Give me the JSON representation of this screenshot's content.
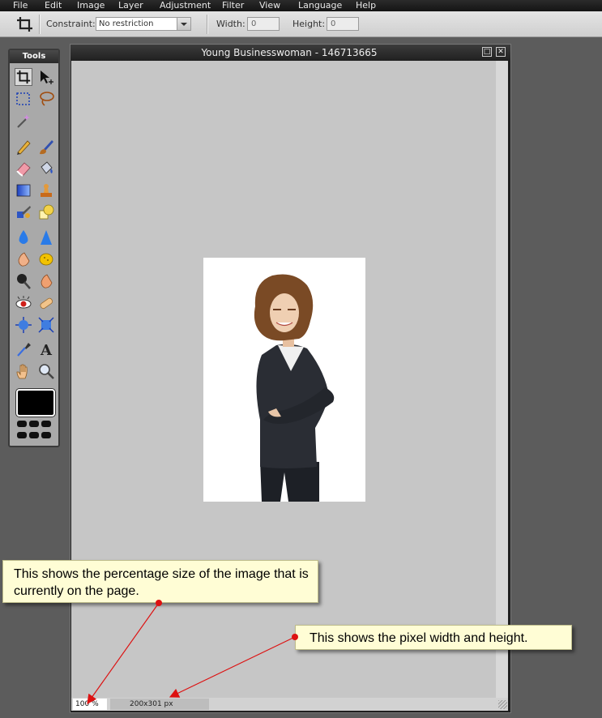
{
  "menu": [
    "File",
    "Edit",
    "Image",
    "Layer",
    "Adjustment",
    "Filter",
    "View",
    "Language",
    "Help"
  ],
  "options": {
    "constraint_label": "Constraint:",
    "constraint_value": "No restriction",
    "width_label": "Width:",
    "width_value": "0",
    "height_label": "Height:",
    "height_value": "0"
  },
  "tools": {
    "title": "Tools",
    "items": [
      "crop-icon",
      "move-icon",
      "marquee-icon",
      "lasso-icon",
      "magic-wand-icon",
      "pencil-icon",
      "brush-icon",
      "eraser-icon",
      "paint-bucket-icon",
      "gradient-icon",
      "stamp-icon",
      "color-replace-icon",
      "shape-icon",
      "blur-icon",
      "sharpen-icon",
      "smudge-icon",
      "sponge-icon",
      "dodge-icon",
      "burn-icon",
      "red-eye-icon",
      "spot-heal-icon",
      "bloat-icon",
      "pinch-icon",
      "color-picker-icon",
      "type-icon",
      "hand-icon",
      "zoom-icon"
    ]
  },
  "document": {
    "title": "Young Businesswoman - 146713665",
    "zoom_value": "100",
    "zoom_unit": "%",
    "dimensions": "200x301 px"
  },
  "callouts": {
    "zoom_note": "This shows the percentage size of the image that is currently on the page.",
    "size_note": "This shows the pixel width and height."
  },
  "colors": {
    "canvas": "#c6c6c6",
    "callout_bg": "#fffdd5",
    "arrow": "#dd1111",
    "foreground_color": "#000000"
  }
}
